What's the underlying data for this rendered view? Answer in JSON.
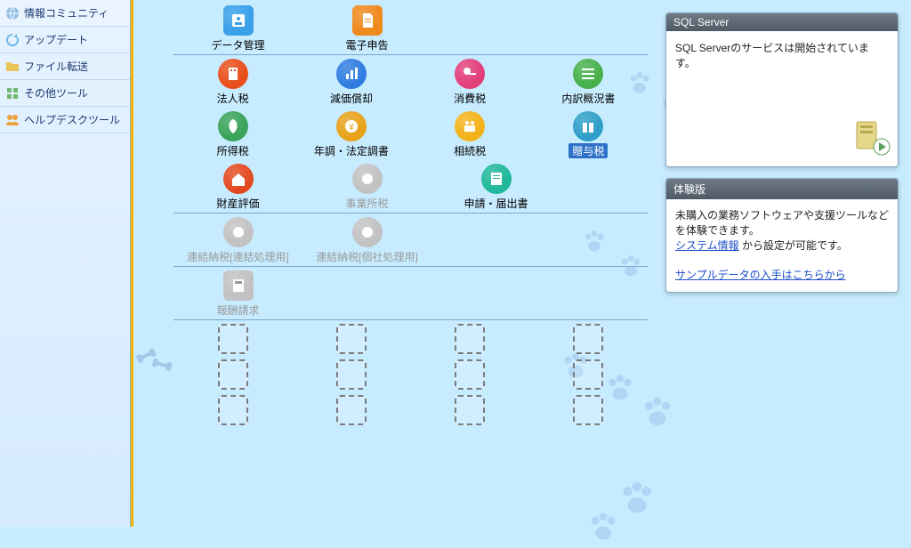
{
  "sidebar": {
    "items": [
      {
        "label": "情報コミュニティ",
        "icon": "globe-icon"
      },
      {
        "label": "アップデート",
        "icon": "refresh-icon"
      },
      {
        "label": "ファイル転送",
        "icon": "folder-icon"
      },
      {
        "label": "その他ツール",
        "icon": "tool-icon"
      },
      {
        "label": "ヘルプデスクツール",
        "icon": "people-icon"
      }
    ]
  },
  "categories": [
    {
      "separator": true,
      "items": [
        {
          "name": "data-management",
          "label": "データ管理",
          "icon": "person-card-icon",
          "bg": "#3aa0e8",
          "shape": "rect"
        },
        {
          "name": "e-filing",
          "label": "電子申告",
          "icon": "doc-icon",
          "bg": "#ef8a1e",
          "shape": "rect"
        }
      ]
    },
    {
      "items": [
        {
          "name": "corporate-tax",
          "label": "法人税",
          "icon": "building-icon",
          "bg": "#e94e1b"
        },
        {
          "name": "depreciation",
          "label": "減価償却",
          "icon": "chart-icon",
          "bg": "#2f7de0"
        },
        {
          "name": "consumption-tax",
          "label": "消費税",
          "icon": "key-icon",
          "bg": "#e23f7a"
        },
        {
          "name": "breakdown",
          "label": "内訳概況書",
          "icon": "bars-icon",
          "bg": "#47b04b"
        }
      ]
    },
    {
      "items": [
        {
          "name": "income-tax",
          "label": "所得税",
          "icon": "leaf-icon",
          "bg": "#3aa35a"
        },
        {
          "name": "year-end",
          "label": "年調・法定調書",
          "icon": "coin-icon",
          "bg": "#e8a31b"
        },
        {
          "name": "inheritance-tax",
          "label": "相続税",
          "icon": "family-icon",
          "bg": "#f4b21a"
        },
        {
          "name": "gift-tax",
          "label": "贈与税",
          "icon": "gift-icon",
          "bg": "#2f9fc9",
          "highlight": true
        }
      ]
    },
    {
      "separator": true,
      "items": [
        {
          "name": "property-valuation",
          "label": "財産評価",
          "icon": "house-icon",
          "bg": "#e34a1f"
        },
        {
          "name": "business-tax",
          "label": "事業所税",
          "icon": "circle-icon",
          "bg": "#c2c2c2",
          "disabled": true
        },
        {
          "name": "application",
          "label": "申請・届出書",
          "icon": "form-icon",
          "bg": "#1fb89a"
        }
      ]
    },
    {
      "separator": true,
      "items": [
        {
          "name": "consolidated-conso",
          "label": "連結納税[連結処理用]",
          "icon": "circle-icon",
          "bg": "#c2c2c2",
          "disabled": true
        },
        {
          "name": "consolidated-single",
          "label": "連結納税[個社処理用]",
          "icon": "circle-icon",
          "bg": "#c2c2c2",
          "disabled": true
        }
      ]
    },
    {
      "separator": true,
      "items": [
        {
          "name": "billing",
          "label": "報酬請求",
          "icon": "calc-icon",
          "bg": "#c2c2c2",
          "shape": "rect",
          "disabled": true
        }
      ]
    },
    {
      "items": [
        {
          "placeholder": true
        },
        {
          "placeholder": true
        },
        {
          "placeholder": true
        },
        {
          "placeholder": true
        }
      ]
    },
    {
      "items": [
        {
          "placeholder": true
        },
        {
          "placeholder": true
        },
        {
          "placeholder": true
        },
        {
          "placeholder": true
        }
      ]
    },
    {
      "items": [
        {
          "placeholder": true
        },
        {
          "placeholder": true
        },
        {
          "placeholder": true
        },
        {
          "placeholder": true
        }
      ]
    }
  ],
  "status_panel": {
    "title": "SQL Server",
    "message": "SQL Serverのサービスは開始されています。"
  },
  "trial_panel": {
    "title": "体験版",
    "line1": "未購入の業務ソフトウェアや支援ツールなどを体験できます。",
    "link1": "システム情報",
    "line2_suffix": " から設定が可能です。",
    "link2": "サンプルデータの入手はこちらから"
  },
  "icon_colors": {
    "globe": "#8fbde3",
    "refresh": "#6fb7e6",
    "folder": "#e8c45b",
    "tool": "#6fb76f",
    "people": "#eba13c"
  }
}
